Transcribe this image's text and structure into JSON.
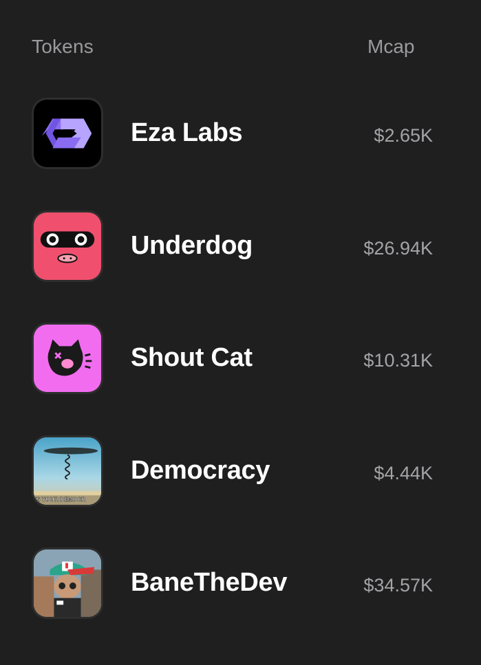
{
  "header": {
    "tokens_label": "Tokens",
    "mcap_label": "Mcap"
  },
  "tokens": [
    {
      "name": "Eza Labs",
      "mcap": "$2.65K",
      "icon": "eza-labs-logo-icon",
      "bg": "#000000"
    },
    {
      "name": "Underdog",
      "mcap": "$26.94K",
      "icon": "underdog-face-icon",
      "bg": "#f0506e"
    },
    {
      "name": "Shout Cat",
      "mcap": "$10.31K",
      "icon": "shout-cat-icon",
      "bg": "#f26cf0"
    },
    {
      "name": "Democracy",
      "mcap": "$4.44K",
      "icon": "democracy-meme-icon",
      "bg": "#6fb7d6",
      "icon_caption": "'S YOUR DEMOCR"
    },
    {
      "name": "BaneTheDev",
      "mcap": "$34.57K",
      "icon": "bane-the-dev-avatar-icon",
      "bg": "#6f8fa6"
    }
  ],
  "colors": {
    "background": "#1f1f1f",
    "header_text": "#9b9b9f",
    "name_text": "#ffffff",
    "mcap_text": "#a4a4a8"
  }
}
